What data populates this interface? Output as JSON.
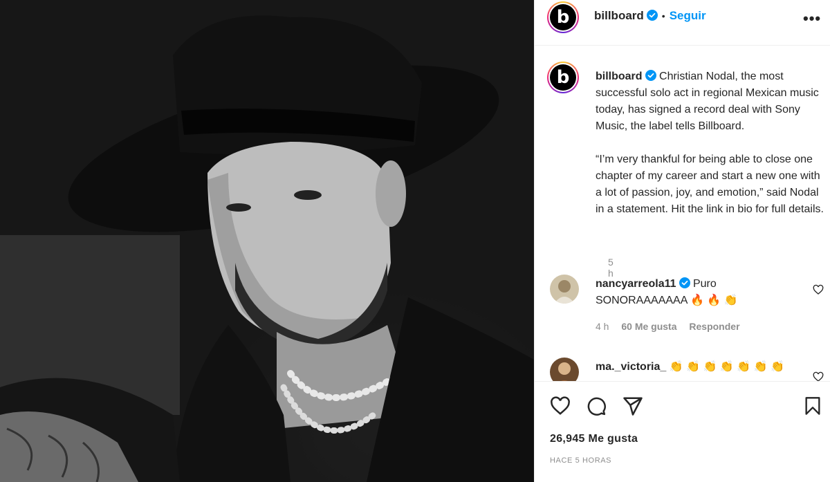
{
  "header": {
    "avatar_letter": "b",
    "username": "billboard",
    "dot": "•",
    "follow_label": "Seguir",
    "more_label": "•••"
  },
  "caption": {
    "username": "billboard",
    "text_p1": "Christian Nodal, the most successful solo act in regional Mexican music today, has signed a record deal with Sony Music, the label tells Billboard.",
    "text_p2": "“I’m very thankful for being able to close one chapter of my career and start a new one with a lot of passion, joy, and emotion,” said Nodal in a statement. Hit the link in bio for full details.",
    "time": "5 h"
  },
  "comments": [
    {
      "username": "nancyarreola11",
      "text": "Puro SONORAAAAAAA",
      "emoji": "🔥 🔥 👏",
      "time": "4 h",
      "likes": "60 Me gusta",
      "reply": "Responder"
    },
    {
      "username": "ma._victoria_",
      "emoji": "👏 👏 👏 👏 👏 👏 👏"
    }
  ],
  "actions": {
    "likes_count": "26,945 Me gusta",
    "time_ago": "HACE 5 HORAS"
  },
  "icons": [
    "verified-badge-icon",
    "heart-icon",
    "comment-icon",
    "share-icon",
    "bookmark-icon",
    "more-icon"
  ],
  "colors": {
    "accent": "#0095f6",
    "text": "#262626",
    "muted": "#8e8e8e",
    "border": "#efefef"
  }
}
